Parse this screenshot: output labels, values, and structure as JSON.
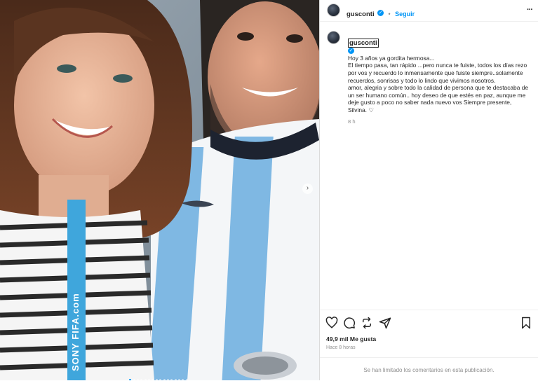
{
  "header": {
    "username": "gusconti",
    "follow_label": "Seguir",
    "more_label": "···"
  },
  "caption": {
    "username": "gusconti",
    "text": "Hoy 3 años ya gordita hermosa...\nEl tiempo pasa, tan rápido ...pero nunca te fuiste, todos los días rezo por vos y recuerdo lo inmensamente que fuiste siempre..solamente recuerdos, sonrisas y todo lo lindo que vivimos nosotros.\namor, alegria y sobre todo la calidad de persona que te destacaba de un ser humano común.. hoy deseo de que estés en paz, aunque me deje gusto a poco no saber nada nuevo vos Siempre presente, Silvina. ♡",
    "time": "8 h"
  },
  "actions": {
    "likes": "49,9 mil Me gusta",
    "posted": "Hace 8 horas",
    "icons": [
      "heart-icon",
      "comment-icon",
      "share-icon",
      "send-icon",
      "bookmark-icon"
    ]
  },
  "comments_notice": "Se han limitado los comentarios en esta publicación.",
  "photo": {
    "lanyard_text": "SONY FIFA.com",
    "carousel_next": "›"
  },
  "colors": {
    "accent": "#0095f6",
    "jersey_blue": "#7fb8e3",
    "text": "#262626",
    "muted": "#8e8e8e"
  }
}
